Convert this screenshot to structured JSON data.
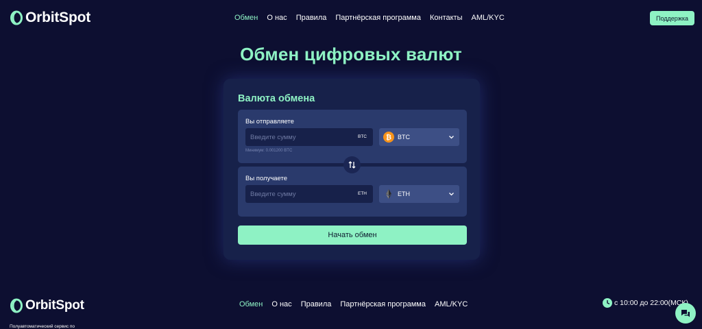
{
  "brand": {
    "name": "OrbitSpot"
  },
  "header": {
    "nav": [
      "Обмен",
      "О нас",
      "Правила",
      "Партнёрская программа",
      "Контакты",
      "AML/KYC"
    ],
    "active_index": 0,
    "support_label": "Поддержка"
  },
  "main": {
    "title": "Обмен цифровых валют",
    "card": {
      "title": "Валюта обмена",
      "send": {
        "label": "Вы отправляете",
        "placeholder": "Введите сумму",
        "unit": "BTC",
        "currency": {
          "code": "BTC",
          "icon": "bitcoin-icon"
        },
        "min_note": "Минимум: 0.001200 BTC"
      },
      "receive": {
        "label": "Вы получаете",
        "placeholder": "Введите сумму",
        "unit": "ETH",
        "currency": {
          "code": "ETH",
          "icon": "ethereum-icon"
        }
      },
      "swap_icon": "swap-arrows-icon",
      "submit_label": "Начать обмен"
    }
  },
  "footer": {
    "nav": [
      "Обмен",
      "О нас",
      "Правила",
      "Партнёрская программа",
      "AML/KYC"
    ],
    "active_index": 0,
    "hours": "с 10:00 до 22:00(МСК)",
    "description": "Полуавтоматический сервис по"
  },
  "colors": {
    "background": "#0d0f31",
    "card": "#17214a",
    "panel": "#2a3a6c",
    "accent": "#8ef2c4",
    "bitcoin": "#f7931a"
  }
}
